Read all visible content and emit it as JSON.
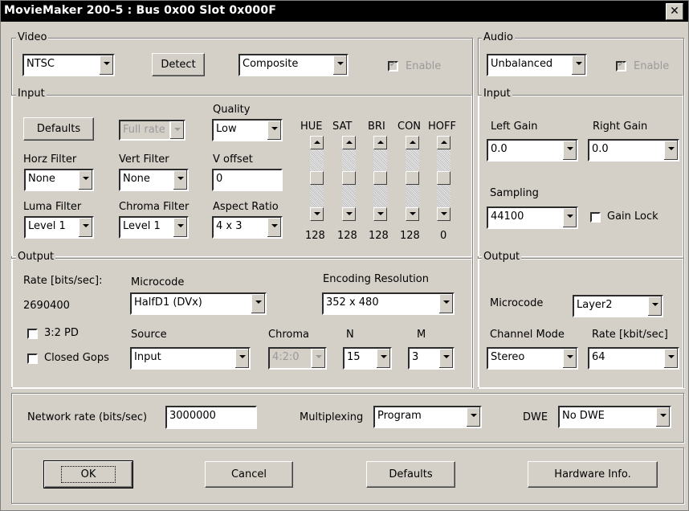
{
  "window": {
    "title": "MovieMaker 200-5 : Bus 0x00 Slot 0x000F",
    "close_label": "✕"
  },
  "video": {
    "legend": "Video",
    "standard": "NTSC",
    "detect_label": "Detect",
    "connector": "Composite",
    "enable_label": "Enable"
  },
  "input": {
    "legend": "Input",
    "defaults_label": "Defaults",
    "fullrate": "Full rate",
    "quality_label": "Quality",
    "quality": "Low",
    "horz_label": "Horz Filter",
    "horz": "None",
    "vert_label": "Vert Filter",
    "vert": "None",
    "voffset_label": "V offset",
    "voffset": "0",
    "luma_label": "Luma Filter",
    "luma": "Level 1",
    "chroma_label": "Chroma Filter",
    "chroma": "Level 1",
    "aspect_label": "Aspect Ratio",
    "aspect": "4 x 3",
    "sliders": [
      {
        "label": "HUE",
        "value": "128"
      },
      {
        "label": "SAT",
        "value": "128"
      },
      {
        "label": "BRI",
        "value": "128"
      },
      {
        "label": "CON",
        "value": "128"
      },
      {
        "label": "HOFF",
        "value": "0"
      }
    ]
  },
  "output": {
    "legend": "Output",
    "rate_label": "Rate [bits/sec]:",
    "rate_value": "2690400",
    "microcode_label": "Microcode",
    "microcode": "HalfD1 (DVx)",
    "encres_label": "Encoding Resolution",
    "encres": "352 x 480",
    "pd_label": "3:2 PD",
    "closedgops_label": "Closed Gops",
    "source_label": "Source",
    "source": "Input",
    "chroma_label": "Chroma",
    "chroma": "4:2:0",
    "n_label": "N",
    "n": "15",
    "m_label": "M",
    "m": "3"
  },
  "audio": {
    "legend": "Audio",
    "balance": "Unbalanced",
    "enable_label": "Enable",
    "input_legend": "Input",
    "left_gain_label": "Left Gain",
    "left_gain": "0.0",
    "right_gain_label": "Right Gain",
    "right_gain": "0.0",
    "sampling_label": "Sampling",
    "sampling": "44100",
    "gainlock_label": "Gain Lock",
    "output_legend": "Output",
    "microcode_label": "Microcode",
    "microcode": "Layer2",
    "channel_label": "Channel Mode",
    "channel": "Stereo",
    "rate_label": "Rate [kbit/sec]",
    "rate": "64"
  },
  "network": {
    "rate_label": "Network rate (bits/sec)",
    "rate": "3000000",
    "mux_label": "Multiplexing",
    "mux": "Program",
    "dwe_label": "DWE",
    "dwe": "No DWE"
  },
  "buttons": {
    "ok": "OK",
    "cancel": "Cancel",
    "defaults": "Defaults",
    "hwinfo": "Hardware Info."
  }
}
